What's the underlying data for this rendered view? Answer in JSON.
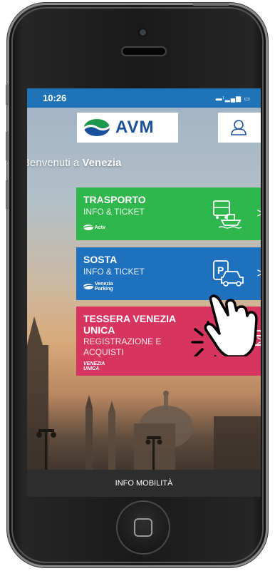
{
  "status_bar": {
    "time": "10:26",
    "indicators": "▬ᵗ▂▄▆ ▭"
  },
  "header": {
    "logo_text": "AVM",
    "logo_icon": "avm-wave-logo",
    "user_icon": "user-icon"
  },
  "welcome": {
    "prefix": "Benvenuti a ",
    "city": "Venezia"
  },
  "cards": [
    {
      "title": "TRASPORTO",
      "subtitle": "INFO & TICKET",
      "brand": "Actv",
      "icon": "bus-boat-icon",
      "color": "#2fb64c"
    },
    {
      "title": "SOSTA",
      "subtitle": "INFO & TICKET",
      "brand": "Venezia Parking",
      "icon": "car-parking-icon",
      "color": "#1f70bd"
    },
    {
      "title_line1": "TESSERA VENEZIA",
      "title_line2": "UNICA",
      "subtitle_line1": "REGISTRAZIONE E",
      "subtitle_line2": "ACQUISTI",
      "brand": "VENEZIA UNICA",
      "icon": "card-icon",
      "color": "#d6355f"
    }
  ],
  "chevron": ">",
  "footer": {
    "label": "INFO MOBILITÀ"
  },
  "colors": {
    "status_bar": "#1f73b7",
    "brand_blue": "#1a4f9a",
    "footer": "#2d2d2d"
  }
}
